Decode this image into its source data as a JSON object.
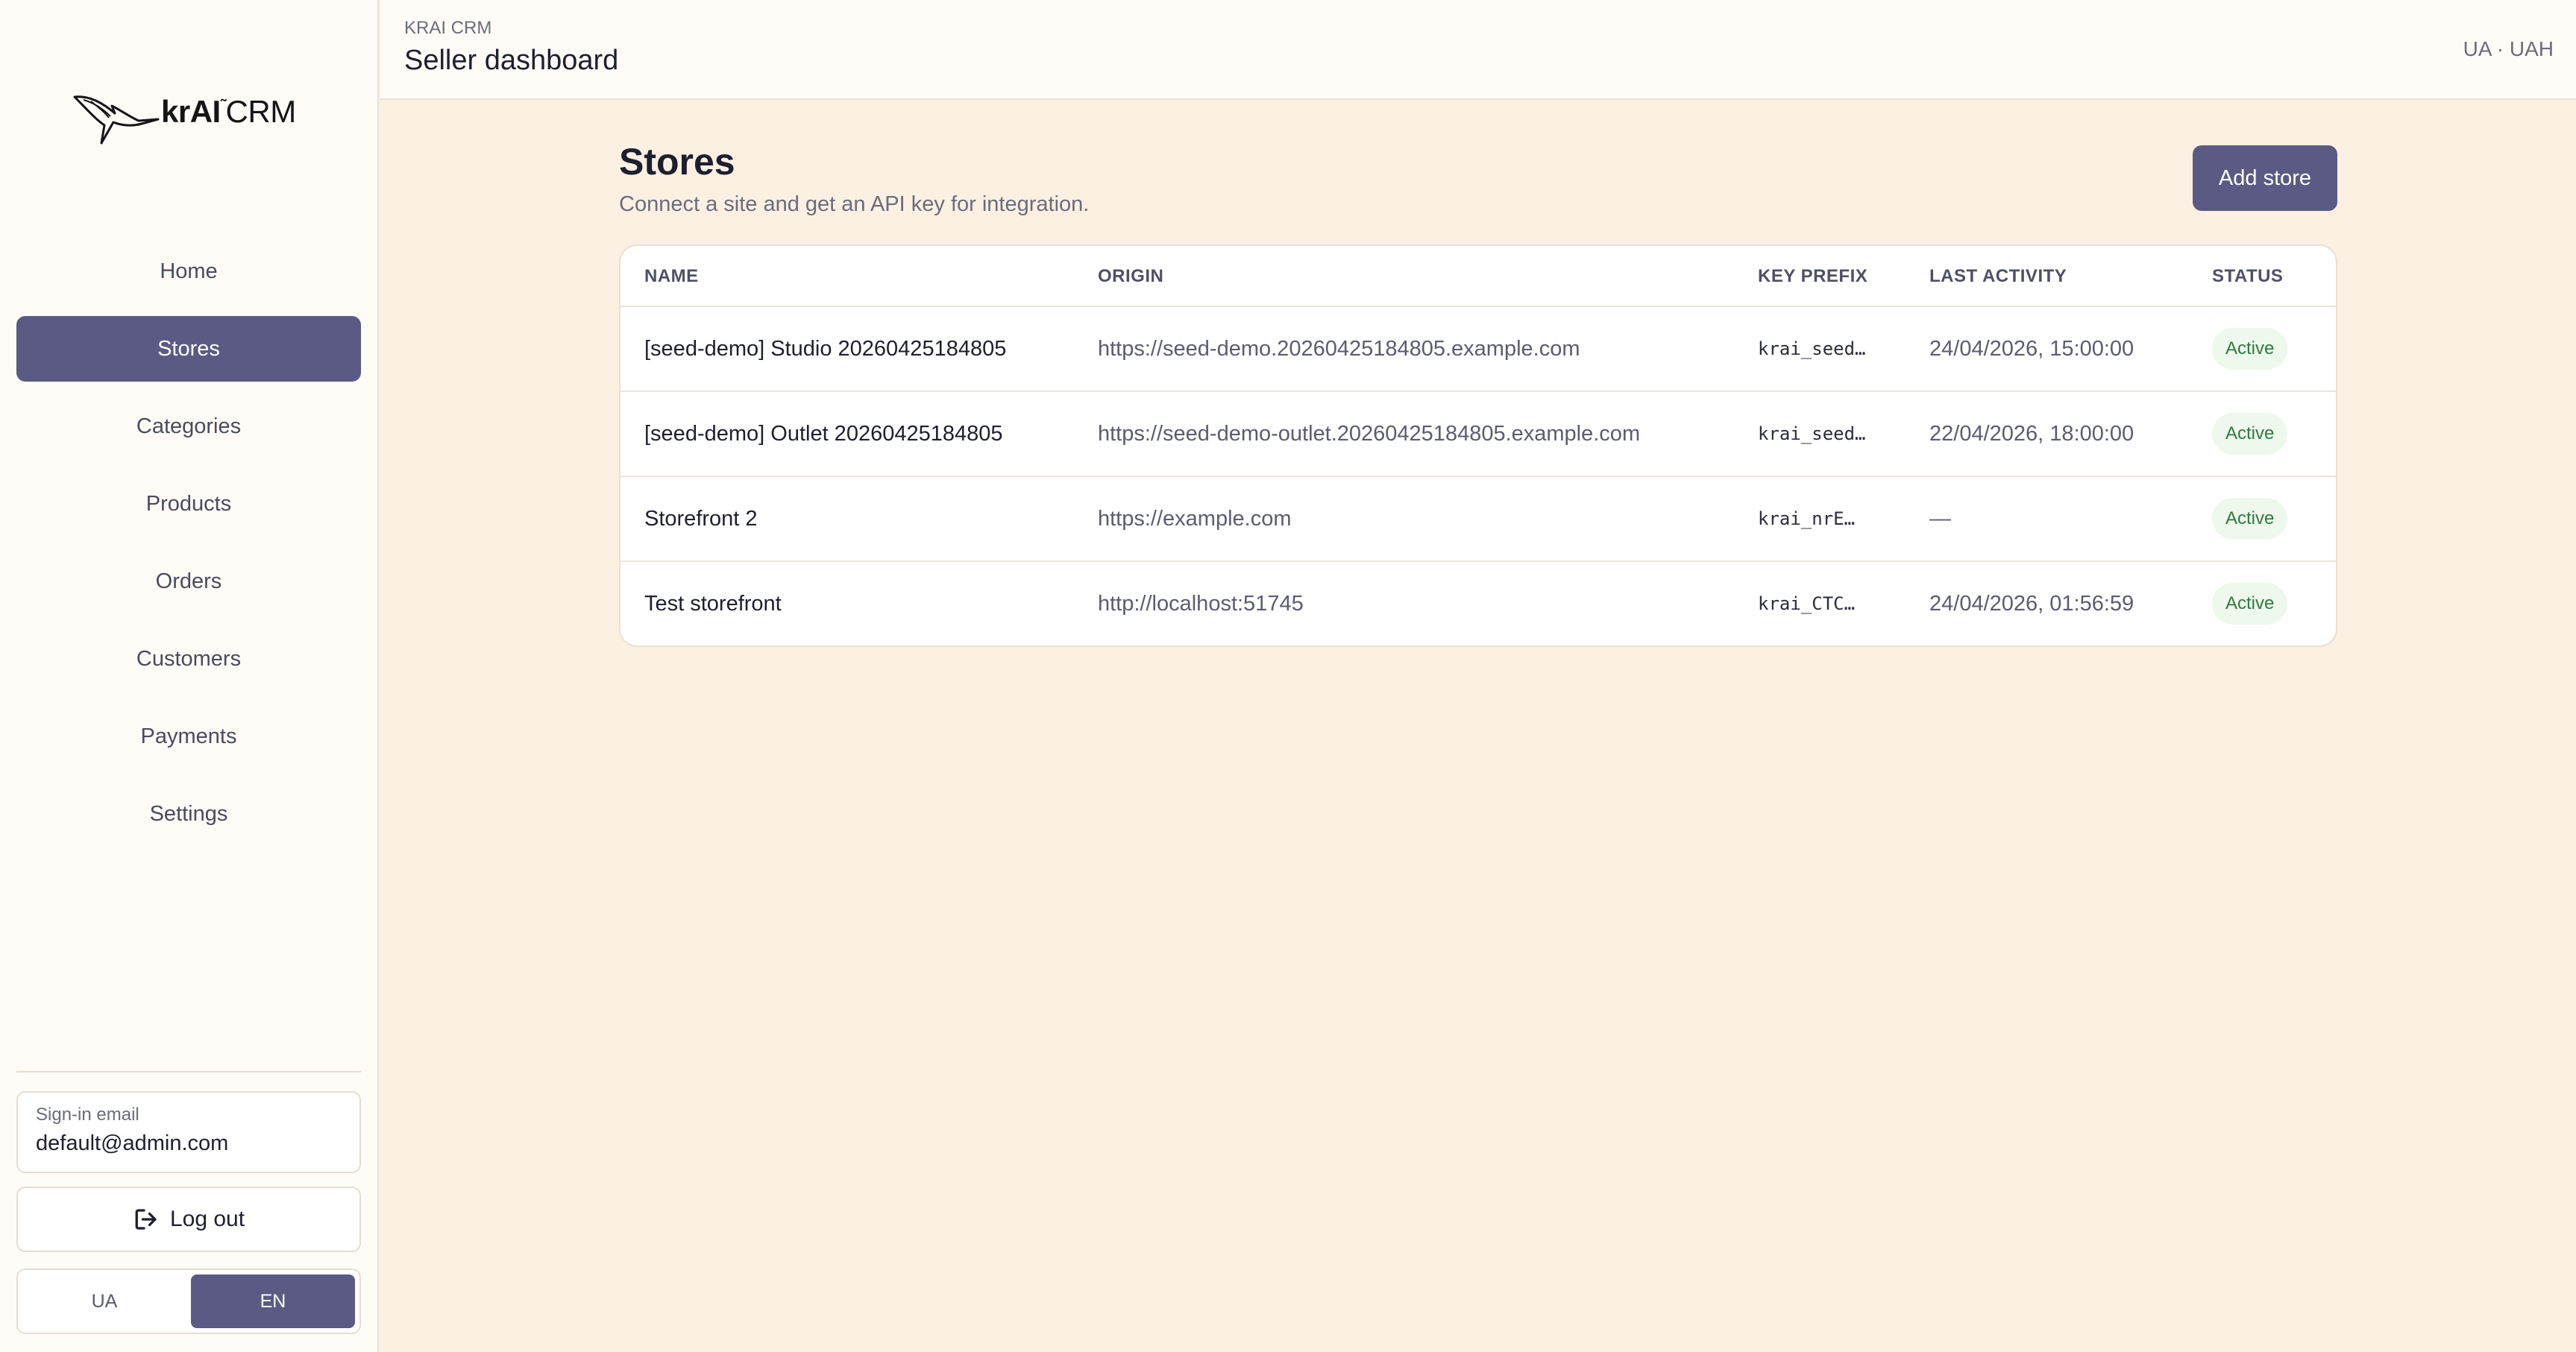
{
  "brand": {
    "logo_text_main": "krAI",
    "logo_text_suffix": "CRM",
    "logo_mark": "heron-icon"
  },
  "header": {
    "kicker": "KRAI CRM",
    "title": "Seller dashboard",
    "locale": "UA · UAH"
  },
  "sidebar": {
    "items": [
      {
        "label": "Home",
        "active": false
      },
      {
        "label": "Stores",
        "active": true
      },
      {
        "label": "Categories",
        "active": false
      },
      {
        "label": "Products",
        "active": false
      },
      {
        "label": "Orders",
        "active": false
      },
      {
        "label": "Customers",
        "active": false
      },
      {
        "label": "Payments",
        "active": false
      },
      {
        "label": "Settings",
        "active": false
      }
    ],
    "email_label": "Sign-in email",
    "email_value": "default@admin.com",
    "logout_label": "Log out",
    "languages": [
      {
        "label": "UA",
        "active": false
      },
      {
        "label": "EN",
        "active": true
      }
    ]
  },
  "main": {
    "title": "Stores",
    "subtitle": "Connect a site and get an API key for integration.",
    "add_button": "Add store",
    "table": {
      "columns": [
        "NAME",
        "ORIGIN",
        "KEY PREFIX",
        "LAST ACTIVITY",
        "STATUS"
      ],
      "rows": [
        {
          "name": "[seed-demo] Studio 20260425184805",
          "origin": "https://seed-demo.20260425184805.example.com",
          "key_prefix": "krai_seed…",
          "last_activity": "24/04/2026, 15:00:00",
          "status": "Active"
        },
        {
          "name": "[seed-demo] Outlet 20260425184805",
          "origin": "https://seed-demo-outlet.20260425184805.example.com",
          "key_prefix": "krai_seed…",
          "last_activity": "22/04/2026, 18:00:00",
          "status": "Active"
        },
        {
          "name": "Storefront 2",
          "origin": "https://example.com",
          "key_prefix": "krai_nrE…",
          "last_activity": "—",
          "status": "Active"
        },
        {
          "name": "Test storefront",
          "origin": "http://localhost:51745",
          "key_prefix": "krai_CTC…",
          "last_activity": "24/04/2026, 01:56:59",
          "status": "Active"
        }
      ]
    }
  },
  "colors": {
    "accent": "#5a5a84",
    "background": "#fbf0e2",
    "status_active_bg": "#eef8ec",
    "status_active_text": "#2f7a3e"
  }
}
